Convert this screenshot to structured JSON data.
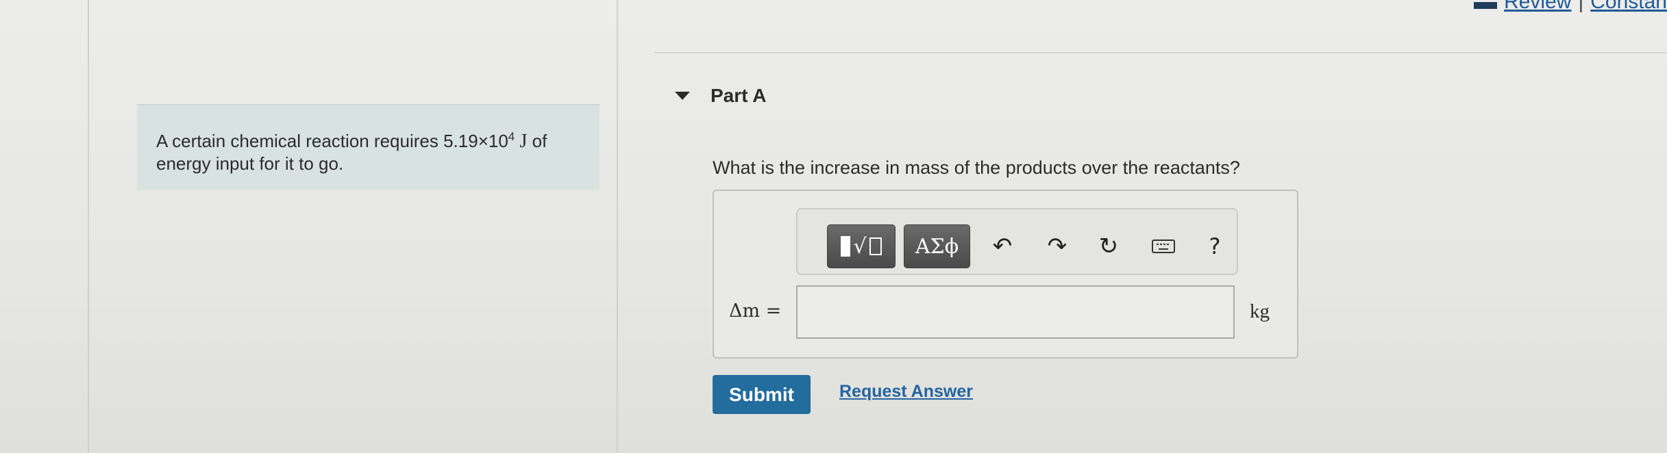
{
  "top_links": {
    "review": "Review",
    "separator": "|",
    "constants": "Constan"
  },
  "intro": {
    "text_prefix": "A certain chemical reaction requires 5.19×10",
    "exponent": "4",
    "unit": "J",
    "text_suffix": " of energy input for it to go."
  },
  "part": {
    "title": "Part A",
    "question": "What is the increase in mass of the products over the reactants?"
  },
  "toolbar": {
    "templates_icon": "templates-icon",
    "symbols_label": "ΑΣϕ",
    "undo_icon": "↶",
    "redo_icon": "↷",
    "reset_icon": "↻",
    "help_label": "?"
  },
  "answer": {
    "variable_label": "Δm =",
    "value": "",
    "placeholder": "",
    "unit": "kg"
  },
  "actions": {
    "submit_label": "Submit",
    "request_answer_label": "Request Answer"
  },
  "colors": {
    "submit_bg": "#236c9e",
    "link": "#2464a0",
    "intro_bg": "#d8e3e1"
  }
}
